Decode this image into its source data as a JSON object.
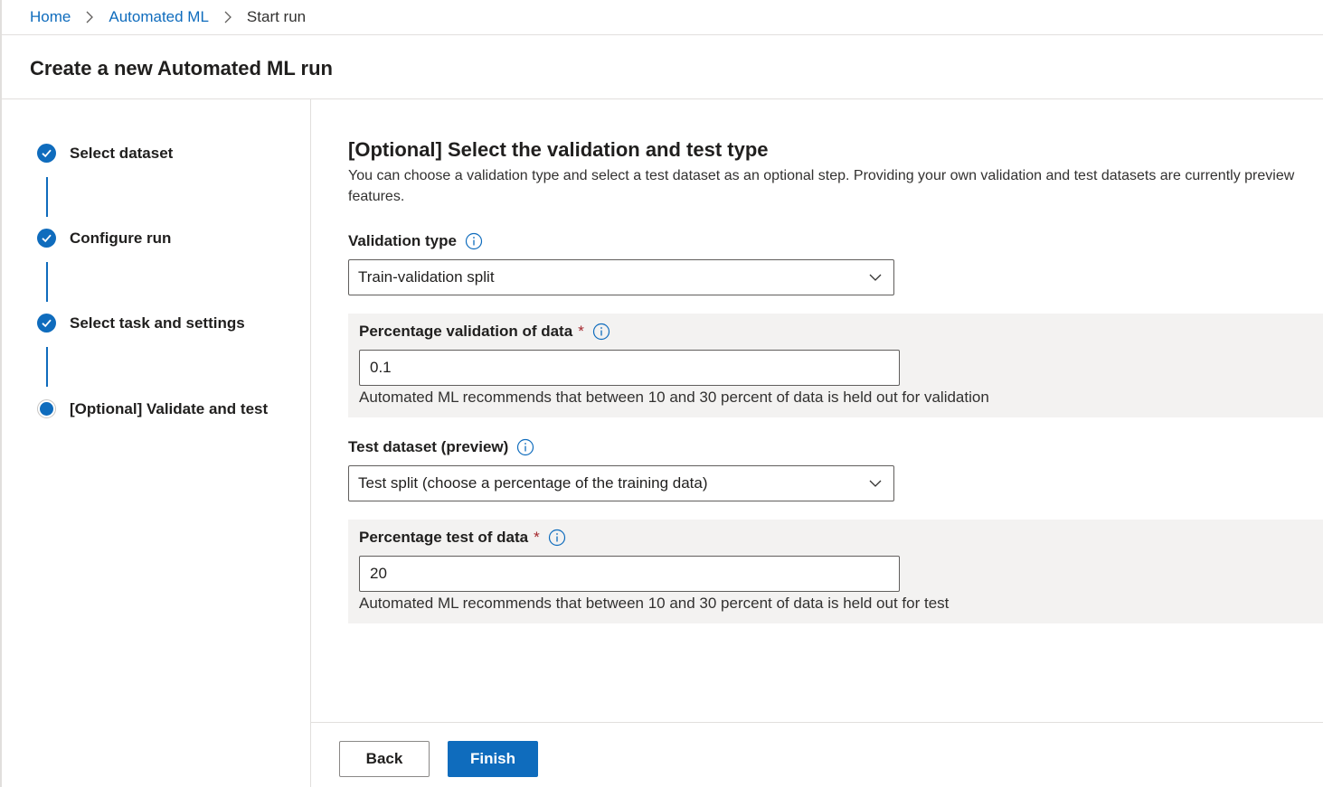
{
  "breadcrumb": {
    "items": [
      "Home",
      "Automated ML"
    ],
    "current": "Start run"
  },
  "page_title": "Create a new Automated ML run",
  "steps": [
    {
      "label": "Select dataset",
      "status": "completed"
    },
    {
      "label": "Configure run",
      "status": "completed"
    },
    {
      "label": "Select task and settings",
      "status": "completed"
    },
    {
      "label": "[Optional] Validate and test",
      "status": "current"
    }
  ],
  "section": {
    "title": "[Optional] Select the validation and test type",
    "description": "You can choose a validation type and select a test dataset as an optional step. Providing your own validation and test datasets are currently preview features."
  },
  "validation_type": {
    "label": "Validation type",
    "value": "Train-validation split"
  },
  "percentage_validation": {
    "label": "Percentage validation of data",
    "required_mark": "*",
    "value": "0.1",
    "hint": "Automated ML recommends that between 10 and 30 percent of data is held out for validation"
  },
  "test_dataset": {
    "label": "Test dataset (preview)",
    "value": "Test split (choose a percentage of the training data)"
  },
  "percentage_test": {
    "label": "Percentage test of data",
    "required_mark": "*",
    "value": "20",
    "hint": "Automated ML recommends that between 10 and 30 percent of data is held out for test"
  },
  "footer": {
    "back_label": "Back",
    "finish_label": "Finish"
  },
  "colors": {
    "accent": "#0f6cbd",
    "required": "#a4262c",
    "panel_bg": "#f3f2f1"
  }
}
